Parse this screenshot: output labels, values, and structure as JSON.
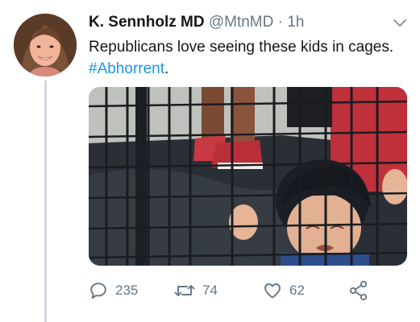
{
  "tweet": {
    "display_name": "K. Sennholz MD",
    "handle": "@MtnMD",
    "separator": "·",
    "time": "1h",
    "text": "Republicans love seeing these kids in cages. ",
    "hashtag": "#Abhorrent",
    "trailing": "."
  },
  "actions": {
    "replies": "235",
    "retweets": "74",
    "likes": "62"
  },
  "icons": {
    "reply": "speech-bubble-icon",
    "retweet": "retweet-arrows-icon",
    "like": "heart-icon",
    "share": "share-nodes-icon",
    "menu": "chevron-down-icon"
  },
  "colors": {
    "link": "#1b95e0",
    "muted": "#657786",
    "text": "#14171a"
  }
}
